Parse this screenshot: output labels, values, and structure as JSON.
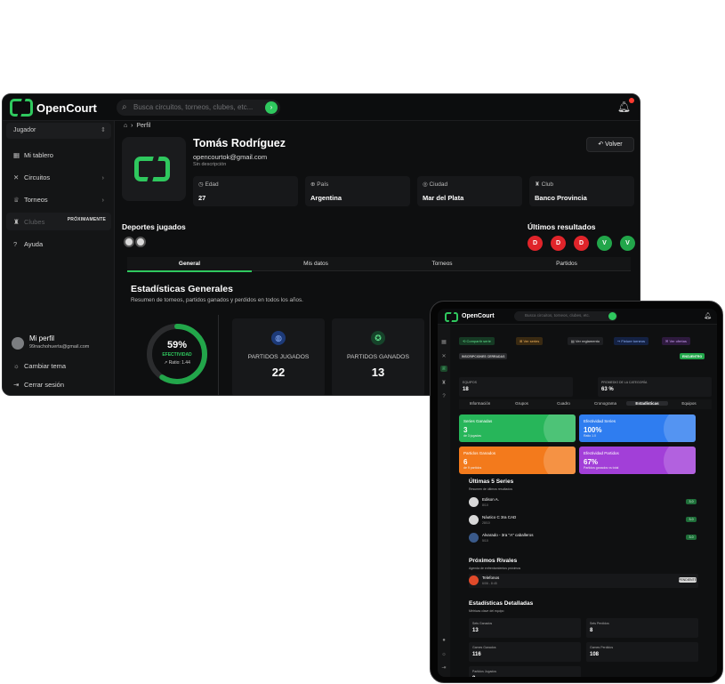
{
  "laptop": {
    "brand": "OpenCourt",
    "search_placeholder": "Busca circuitos, torneos, clubes, etc...",
    "role": "Jugador",
    "nav": [
      {
        "label": "Mi tablero",
        "icon": "dashboard-icon"
      },
      {
        "label": "Circuitos",
        "icon": "circuits-icon"
      },
      {
        "label": "Torneos",
        "icon": "trophy-icon"
      },
      {
        "label": "Clubes",
        "icon": "clubs-icon",
        "badge": "PRÓXIMAMENTE"
      },
      {
        "label": "Ayuda",
        "icon": "help-icon"
      }
    ],
    "profile": {
      "name": "Mi perfil",
      "email": "99nachohuerta@gmail.com",
      "theme": "Cambiar tema",
      "logout": "Cerrar sesión"
    },
    "breadcrumb": "Perfil",
    "user": {
      "name": "Tomás Rodríguez",
      "email": "opencourtok@gmail.com",
      "desc": "Sin descripción"
    },
    "back_label": "Volver",
    "info": [
      {
        "label": "Edad",
        "value": "27"
      },
      {
        "label": "País",
        "value": "Argentina"
      },
      {
        "label": "Ciudad",
        "value": "Mar del Plata"
      },
      {
        "label": "Club",
        "value": "Banco Provincia"
      }
    ],
    "sports_title": "Deportes jugados",
    "results_title": "Últimos resultados",
    "results": [
      "D",
      "D",
      "D",
      "V",
      "V"
    ],
    "tabs": [
      "General",
      "Mis datos",
      "Torneos",
      "Partidos"
    ],
    "stats_title": "Estadísticas Generales",
    "stats_subtitle": "Resumen de torneos, partidos ganados y perdidos en todos los años.",
    "effectiveness": {
      "percent": "59%",
      "label": "EFECTIVIDAD",
      "ratio": "↗ Ratio: 1.44",
      "value": 0.59
    },
    "stat_cards": [
      {
        "label": "PARTIDOS JUGADOS",
        "value": "22"
      },
      {
        "label": "PARTIDOS GANADOS",
        "value": "13"
      }
    ]
  },
  "tablet": {
    "brand": "OpenCourt",
    "search_placeholder": "Busca circuitos, torneos, clubes, etc.",
    "buttons": [
      "Compartir serie",
      "Ver series",
      "Ver reglamento",
      "Fixture torneos",
      "Ver ofertas"
    ],
    "pill_left": "INSCRIPCIONES CERRADAS",
    "pill_right": "ENCUENTRO",
    "info": [
      {
        "label": "EQUIPOS",
        "value": "18"
      },
      {
        "label": "PROMEDIO DE LA CATEGORÍA",
        "value": "63 %"
      }
    ],
    "tabs": [
      "Información",
      "Grupos",
      "Cuadro",
      "Cronograma",
      "Estadísticas",
      "Equipos"
    ],
    "cards": [
      {
        "label": "Series Ganadas",
        "value": "3",
        "sub": "de 3 jugadas"
      },
      {
        "label": "Efectividad Series",
        "value": "100%",
        "sub": "Ratio 1.0"
      },
      {
        "label": "Partidos Ganados",
        "value": "6",
        "sub": "de 9 partidos"
      },
      {
        "label": "Efectividad Partidos",
        "value": "67%",
        "sub": "Partidos ganados vs total"
      }
    ],
    "last_series_title": "Últimas 5 Series",
    "last_series_sub": "Resumen de últimos resultados",
    "series": [
      {
        "name": "Edison A.",
        "date": "8/10"
      },
      {
        "name": "Náutico C 3ra CAD",
        "date": "28/10"
      },
      {
        "name": "Alvarado - 3ra \"A\" caballeros",
        "date": "5/10"
      }
    ],
    "series_result": "3-0",
    "rivals_title": "Próximos Rivales",
    "rivals_sub": "Agenda de enfrentamientos próximos",
    "rival": {
      "name": "Telefonos",
      "date": "6/06 - 8:45",
      "badge": "PENDIENTE"
    },
    "detail_title": "Estadísticas Detalladas",
    "detail_sub": "Métricas clave del equipo",
    "details": [
      {
        "label": "Sets Ganados",
        "value": "13"
      },
      {
        "label": "Sets Perdidos",
        "value": "8"
      },
      {
        "label": "Games Ganados",
        "value": "116"
      },
      {
        "label": "Games Perdidos",
        "value": "108"
      },
      {
        "label": "Partidos Jugados",
        "value": "9"
      }
    ]
  }
}
